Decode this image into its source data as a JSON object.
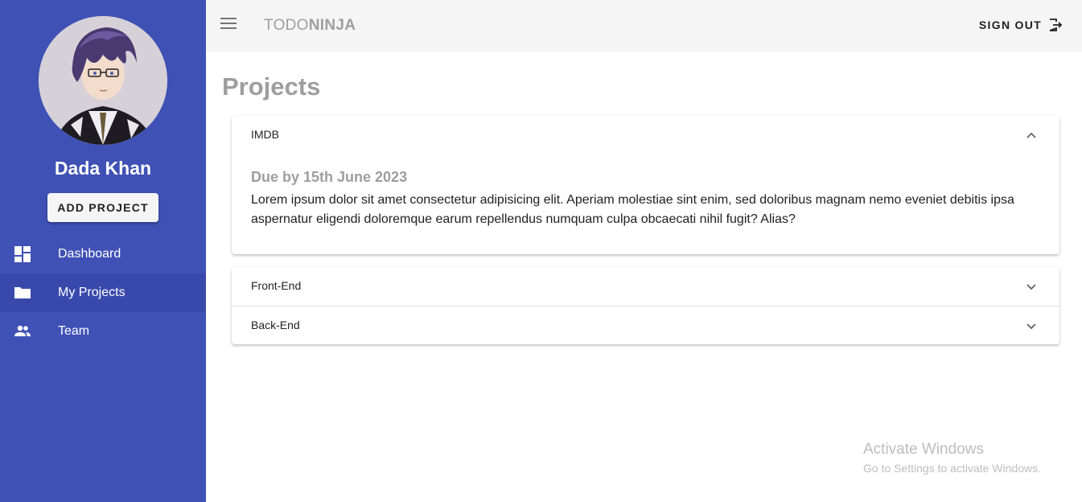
{
  "sidebar": {
    "user_name": "Dada Khan",
    "add_project_label": "ADD PROJECT",
    "items": [
      {
        "label": "Dashboard",
        "icon": "dashboard-icon"
      },
      {
        "label": "My Projects",
        "icon": "folder-icon"
      },
      {
        "label": "Team",
        "icon": "people-icon"
      }
    ],
    "active_item": "My Projects",
    "color": "#3f51b5"
  },
  "topbar": {
    "brand_light": "TODO",
    "brand_bold": "NINJA",
    "sign_out_label": "SIGN OUT",
    "menu_icon": "menu-icon",
    "sign_out_icon": "exit-icon"
  },
  "main": {
    "title": "Projects",
    "projects": [
      {
        "name": "IMDB",
        "expanded": true,
        "due": "Due by 15th June 2023",
        "description": "Lorem ipsum dolor sit amet consectetur adipisicing elit. Aperiam molestiae sint enim, sed doloribus magnam nemo eveniet debitis ipsa aspernatur eligendi doloremque earum repellendus numquam culpa obcaecati nihil fugit? Alias?"
      },
      {
        "name": "Front-End",
        "expanded": false
      },
      {
        "name": "Back-End",
        "expanded": false
      }
    ]
  },
  "watermark": {
    "title": "Activate Windows",
    "subtitle": "Go to Settings to activate Windows."
  }
}
